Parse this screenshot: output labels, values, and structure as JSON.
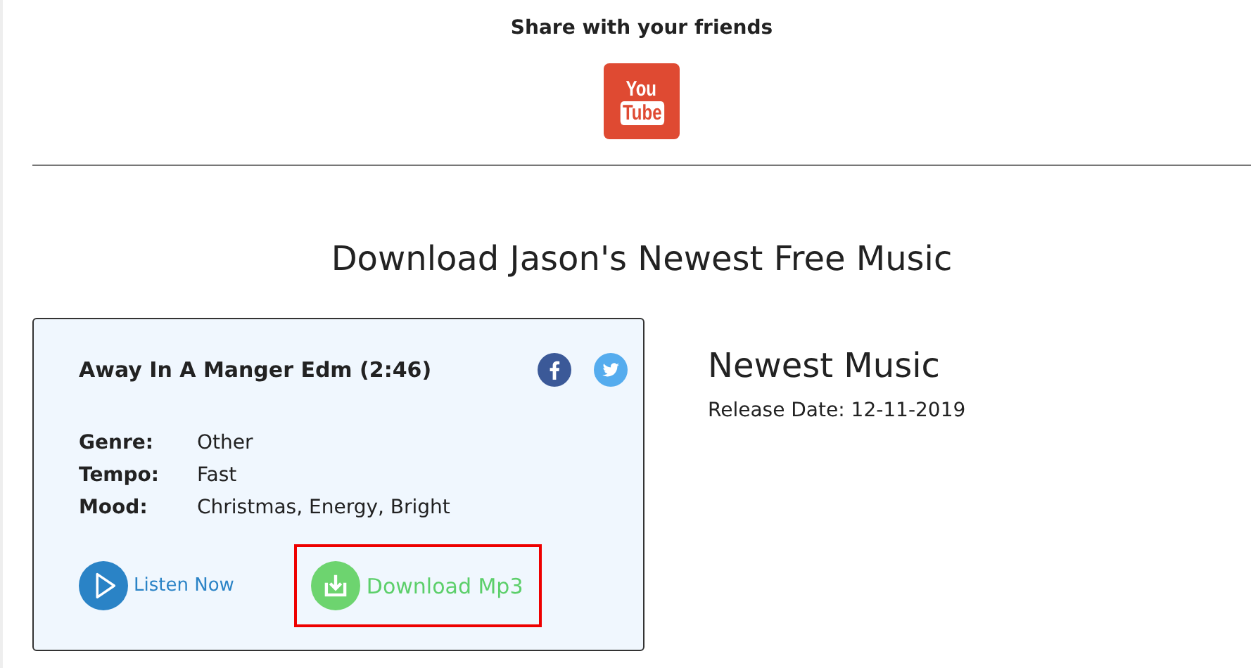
{
  "share": {
    "title": "Share with your friends",
    "logo_lines": [
      "You",
      "Tube"
    ]
  },
  "heading": "Download Jason's Newest Free Music",
  "track": {
    "title": "Away In A Manger Edm (2:46)",
    "details": [
      {
        "label": "Genre:",
        "value": "Other"
      },
      {
        "label": "Tempo:",
        "value": "Fast"
      },
      {
        "label": "Mood:",
        "value": "Christmas, Energy, Bright"
      }
    ],
    "listen": "Listen Now",
    "download": "Download Mp3",
    "download_highlighted": true
  },
  "newest": {
    "title": "Newest Music",
    "release": "Release Date: 12-11-2019"
  }
}
